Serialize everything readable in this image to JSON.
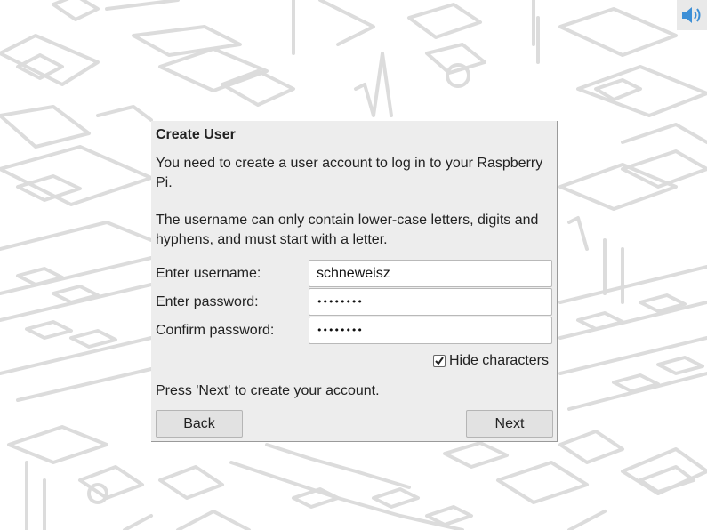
{
  "tray": {
    "icon": "volume-icon"
  },
  "dialog": {
    "title": "Create User",
    "message_1": "You need to create a user account to log in to your Raspberry Pi.",
    "message_2": "The username can only contain lower-case letters, digits and hyphens, and must start with a letter.",
    "username_label": "Enter username:",
    "username_value": "schneweisz",
    "password_label": "Enter password:",
    "password_value": "••••••••",
    "confirm_label": "Confirm password:",
    "confirm_value": "••••••••",
    "hide_characters_label": "Hide characters",
    "hide_characters_checked": true,
    "prompt": "Press 'Next' to create your account.",
    "back_label": "Back",
    "next_label": "Next"
  }
}
